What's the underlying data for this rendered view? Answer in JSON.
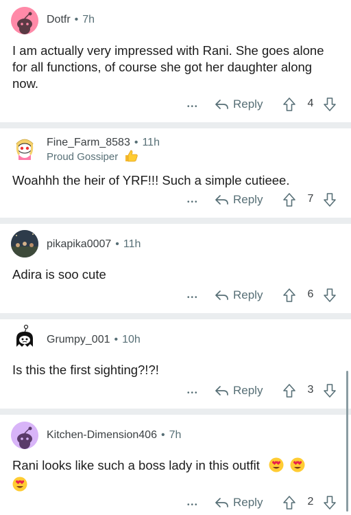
{
  "comments": [
    {
      "username": "Dotfr",
      "time": "7h",
      "flair": "",
      "text": "I am actually very impressed with Rani. She goes alone for all functions, of course she got her daughter along now.",
      "reply_label": "Reply",
      "votes": "4",
      "avatar_color": "#ff8aa8"
    },
    {
      "username": "Fine_Farm_8583",
      "time": "11h",
      "flair": "Proud Gossiper",
      "text": "Woahhh the heir of YRF!!! Such a simple cutieee.",
      "reply_label": "Reply",
      "votes": "7",
      "avatar_color": "#f5d16b"
    },
    {
      "username": "pikapika0007",
      "time": "11h",
      "flair": "",
      "text": "Adira is soo cute",
      "reply_label": "Reply",
      "votes": "6",
      "avatar_color": "#2d3b4a"
    },
    {
      "username": "Grumpy_001",
      "time": "10h",
      "flair": "",
      "text": "Is this the first sighting?!?!",
      "reply_label": "Reply",
      "votes": "3",
      "avatar_color": "#ffffff"
    },
    {
      "username": "Kitchen-Dimension406",
      "time": "7h",
      "flair": "",
      "text": "Rani looks like such a boss lady in this outfit",
      "reply_label": "Reply",
      "votes": "2",
      "avatar_color": "#d8b4f8"
    }
  ],
  "separator": "•",
  "more_label": "•••",
  "emojis": [
    "heart-eyes-emoji",
    "heart-eyes-emoji",
    "heart-eyes-emoji"
  ],
  "colors": {
    "meta": "#576f76",
    "divider": "#eaedef",
    "text": "#1c1c1c"
  }
}
